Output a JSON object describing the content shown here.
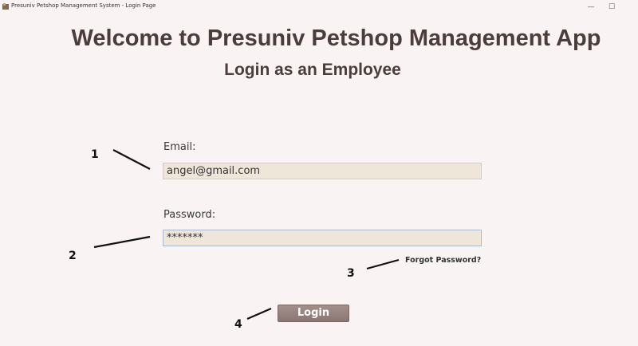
{
  "window": {
    "title": "Presuniv Petshop Management System - Login Page",
    "controls": {
      "minimize": "—",
      "maximize": "☐",
      "close": ""
    }
  },
  "header": {
    "welcome": "Welcome to Presuniv Petshop Management App",
    "subtitle": "Login as an Employee"
  },
  "form": {
    "email_label": "Email:",
    "email_value": "angel@gmail.com",
    "password_label": "Password:",
    "password_value": "*******",
    "forgot_link": "Forgot Password?",
    "login_button": "Login"
  },
  "annotations": {
    "n1": "1",
    "n2": "2",
    "n3": "3",
    "n4": "4"
  },
  "colors": {
    "background": "#f9f4f3",
    "heading": "#4a3d3b",
    "field_bg": "#efe6da",
    "button": "#8a7672"
  }
}
